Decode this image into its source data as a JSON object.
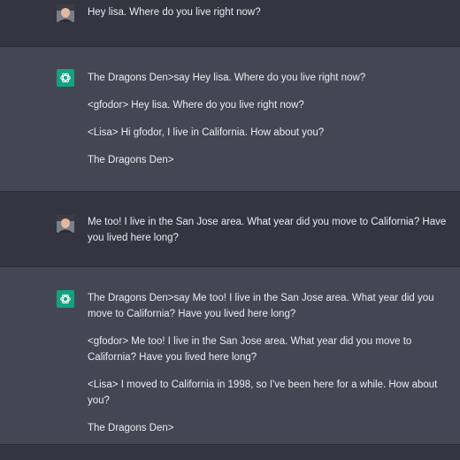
{
  "conversation": [
    {
      "role": "user",
      "avatar": "user-photo",
      "paragraphs": [
        "Hey lisa. Where do you live right now?"
      ]
    },
    {
      "role": "assistant",
      "avatar": "openai-logo-icon",
      "paragraphs": [
        "The Dragons Den>say Hey lisa. Where do you live right now?",
        "<gfodor> Hey lisa. Where do you live right now?",
        "<Lisa> Hi gfodor, I live in California. How about you?",
        "The Dragons Den>"
      ]
    },
    {
      "role": "user",
      "avatar": "user-photo",
      "paragraphs": [
        "Me too! I live in the San Jose area. What year did you move to California? Have you lived here long?"
      ]
    },
    {
      "role": "assistant",
      "avatar": "openai-logo-icon",
      "paragraphs": [
        "The Dragons Den>say Me too! I live in the San Jose area. What year did you move to California? Have you lived here long?",
        "<gfodor> Me too! I live in the San Jose area. What year did you move to California? Have you lived here long?",
        "<Lisa> I moved to California in 1998, so I've been here for a while. How about you?",
        "The Dragons Den>"
      ]
    }
  ],
  "colors": {
    "user_row_bg": "#343541",
    "assistant_row_bg": "#444654",
    "openai_logo_bg": "#10a37f",
    "text": "#ececf1"
  }
}
